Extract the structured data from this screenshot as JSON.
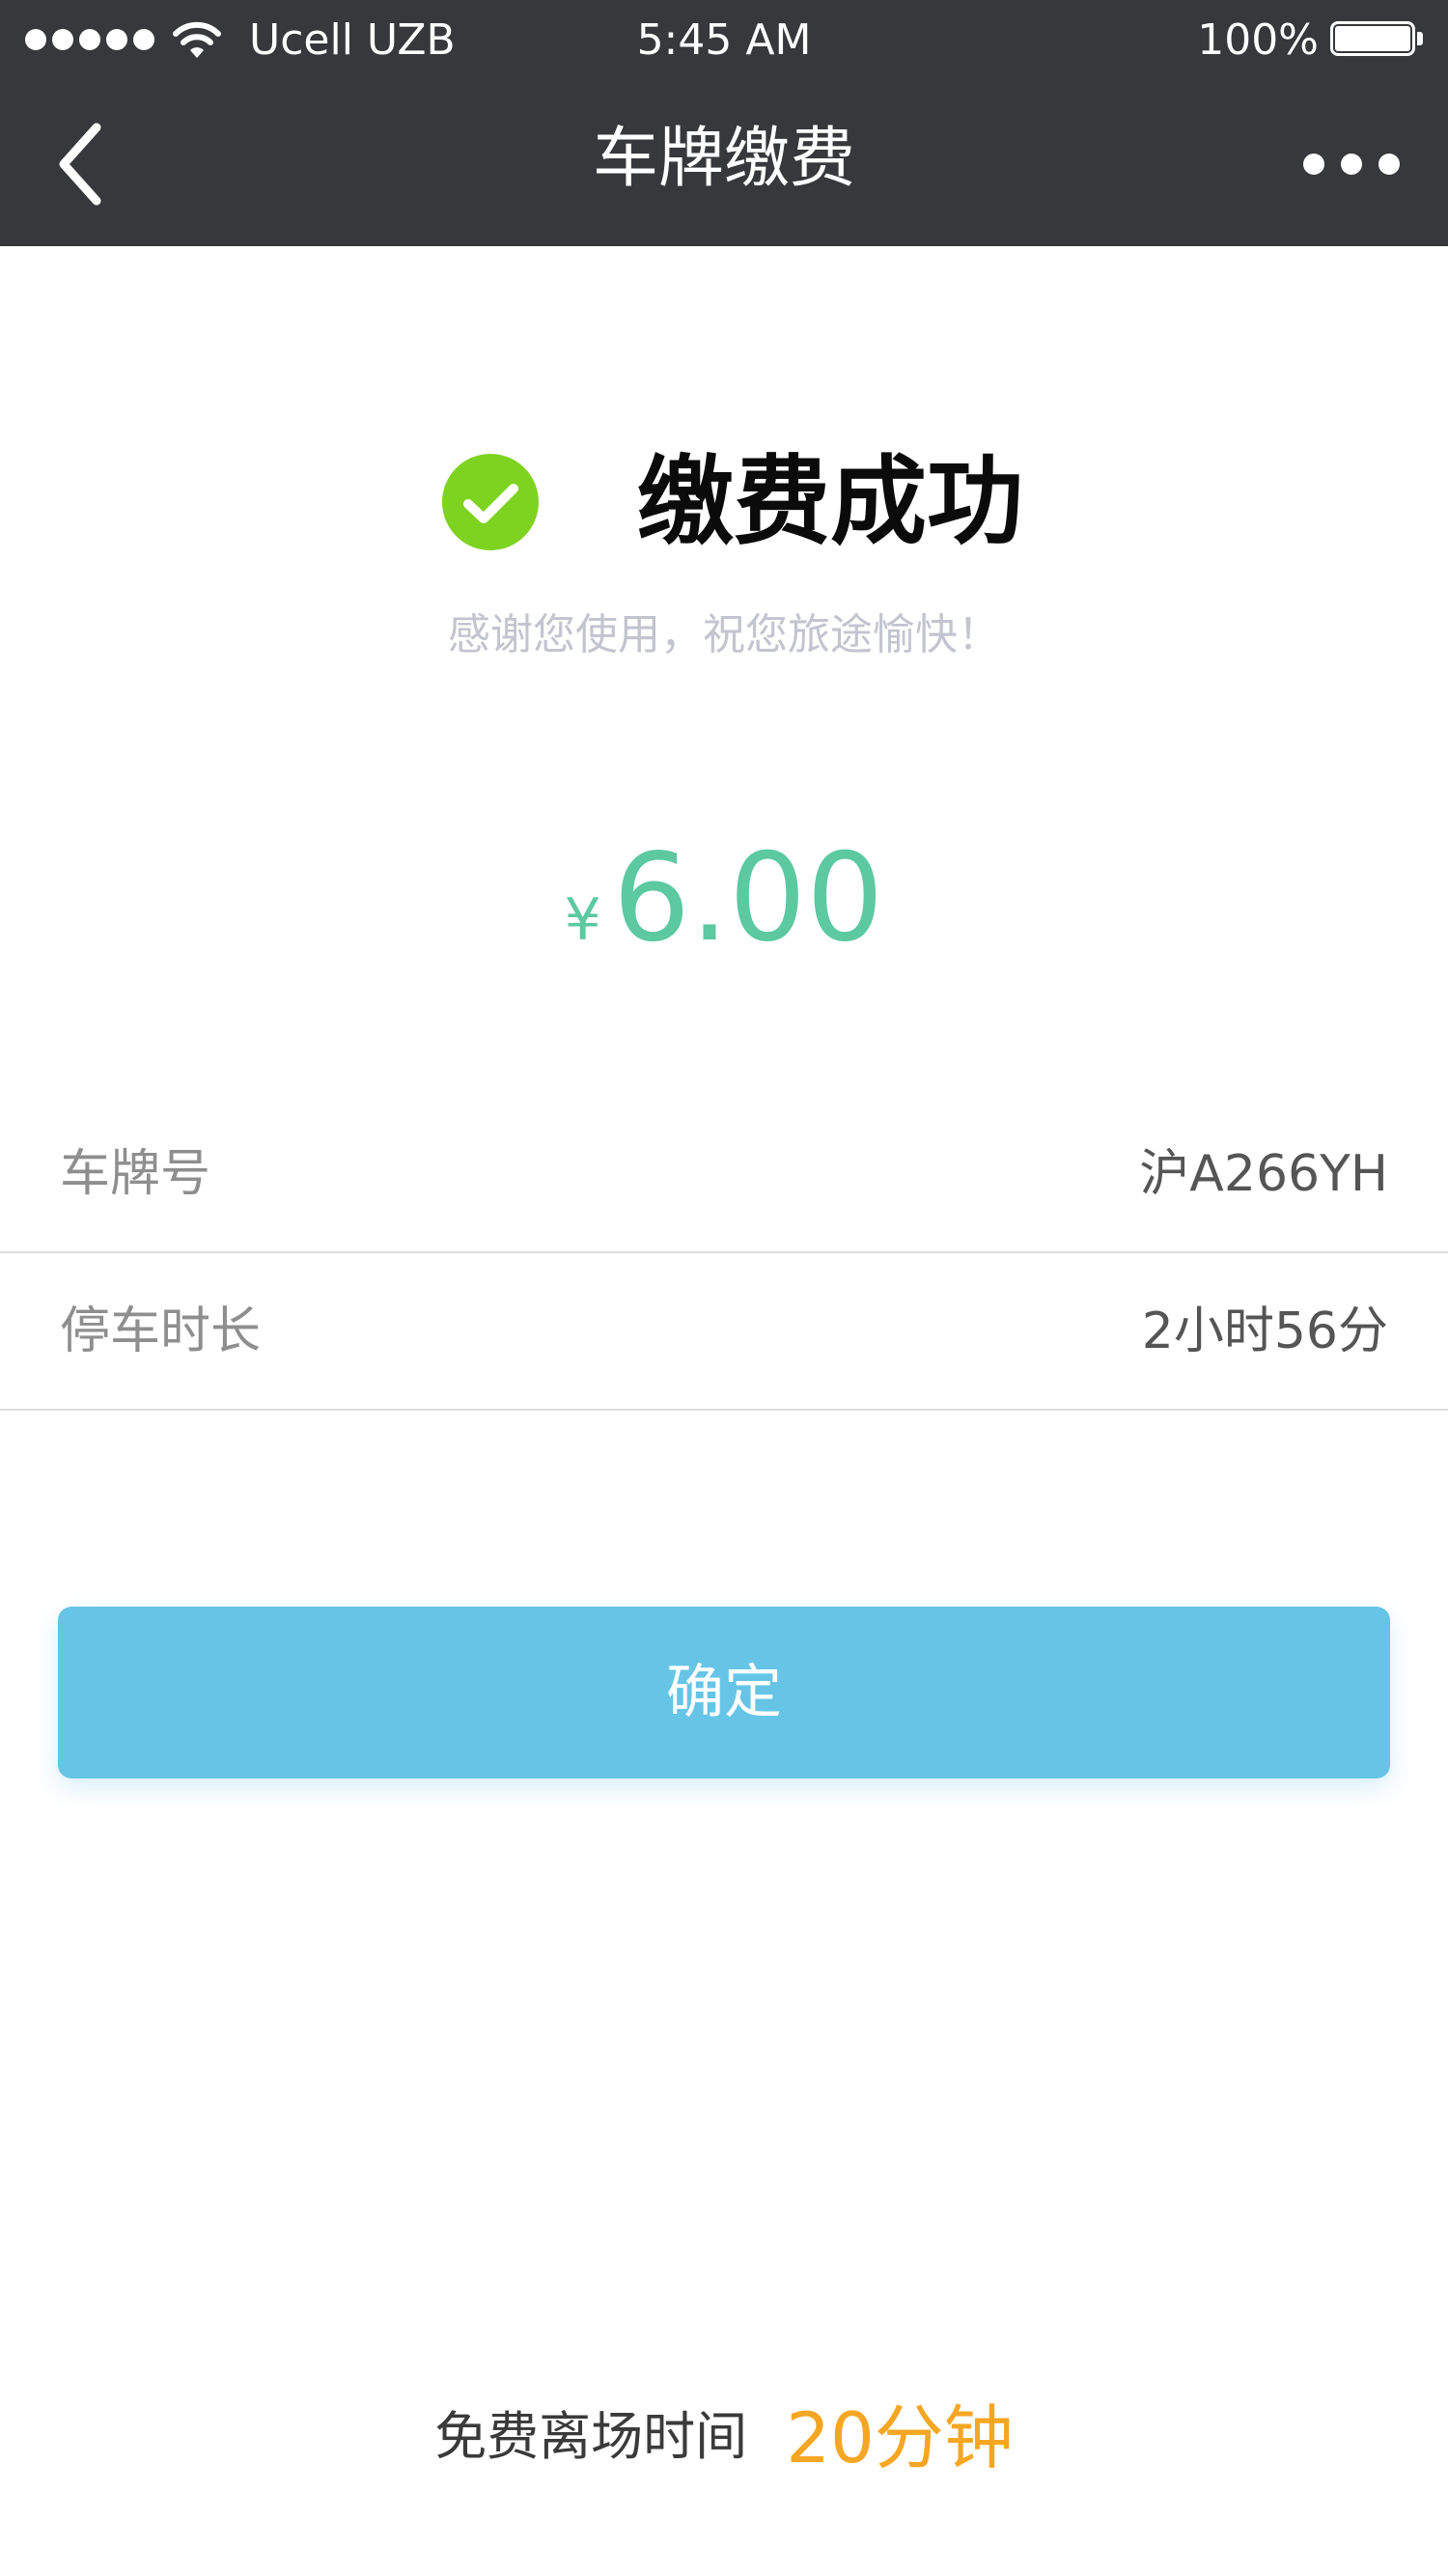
{
  "status_bar": {
    "carrier": "Ucell UZB",
    "time": "5:45 AM",
    "battery_percent": "100%",
    "battery_level": 1.0,
    "signal_bars": 5
  },
  "nav": {
    "title": "车牌缴费",
    "back_icon": "chevron-left-icon",
    "more_icon": "more-horizontal-icon"
  },
  "result": {
    "icon": "check-circle-icon",
    "icon_color": "#7ed321",
    "title": "缴费成功",
    "subtitle": "感谢您使用，祝您旅途愉快！"
  },
  "payment": {
    "currency_symbol": "¥",
    "amount": "6.00",
    "accent_color": "#5cc9a0"
  },
  "details": [
    {
      "label": "车牌号",
      "value": "沪A266YH"
    },
    {
      "label": "停车时长",
      "value": "2小时56分"
    }
  ],
  "actions": {
    "confirm_label": "确定",
    "confirm_color": "#66c5e6"
  },
  "footer": {
    "label": "免费离场时间",
    "value": "20分钟",
    "value_color": "#f5a623"
  }
}
